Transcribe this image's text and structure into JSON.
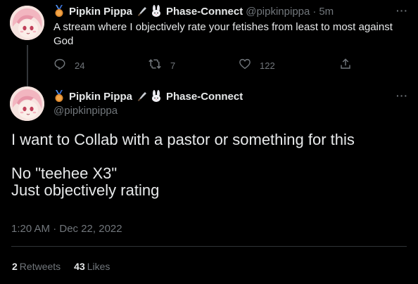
{
  "reply_tweet": {
    "author_name": "Pipkin Pippa",
    "affiliation": "Phase-Connect",
    "handle": "@pipkinpippa",
    "separator": "·",
    "time": "5m",
    "text": "A stream where I objectively rate your fetishes from least to most against God",
    "more": "···",
    "actions": {
      "reply_count": "24",
      "retweet_count": "7",
      "like_count": "122"
    }
  },
  "main_tweet": {
    "author_name": "Pipkin Pippa",
    "affiliation": "Phase-Connect",
    "handle": "@pipkinpippa",
    "more": "···",
    "text_line1": "I want to Collab with a pastor or something for this",
    "text_line2": "No \"teehee X3\"",
    "text_line3": "Just objectively rating",
    "timestamp": "1:20 AM · Dec 22, 2022",
    "retweets_count": "2",
    "retweets_label": "Retweets",
    "likes_count": "43",
    "likes_label": "Likes"
  },
  "colors": {
    "background": "#000000",
    "text": "#e7e9ea",
    "muted": "#71767b",
    "divider": "#2f3336"
  }
}
